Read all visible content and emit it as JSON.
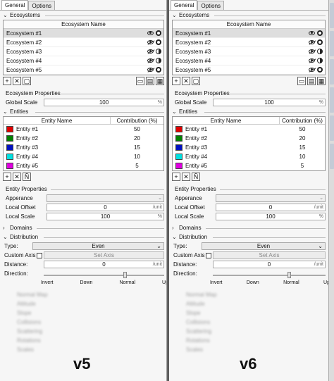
{
  "panels": [
    {
      "tabs": [
        "General",
        "Options"
      ],
      "ecosystems": {
        "header": "Ecosystems",
        "column": "Ecosystem Name",
        "items": [
          {
            "name": "Ecosystem #1",
            "eye": "eye-icon",
            "mode": "gear-icon"
          },
          {
            "name": "Ecosystem #2",
            "eye": "eye-hidden-icon",
            "mode": "gear-icon"
          },
          {
            "name": "Ecosystem #3",
            "eye": "eye-hidden-icon",
            "mode": "half-circle-icon"
          },
          {
            "name": "Ecosystem #4",
            "eye": "eye-hidden-icon",
            "mode": "half-circle-icon"
          },
          {
            "name": "Ecosystem #5",
            "eye": "eye-hidden-icon",
            "mode": "gear-icon"
          }
        ],
        "toolbar": [
          "+",
          "✕",
          "▢"
        ],
        "toolbar_right": [
          "▭",
          "▤",
          "▦"
        ]
      },
      "eco_props": {
        "header": "Ecosystem Properties",
        "scale_label": "Global Scale",
        "scale_value": "100",
        "scale_unit": "%"
      },
      "entities": {
        "header": "Entities",
        "col_name": "Entity Name",
        "col_contrib": "Contribution (%)",
        "items": [
          {
            "name": "Entity #1",
            "value": "50",
            "color": "#e00000"
          },
          {
            "name": "Entity #2",
            "value": "20",
            "color": "#008000"
          },
          {
            "name": "Entity #3",
            "value": "15",
            "color": "#0010c0"
          },
          {
            "name": "Entity #4",
            "value": "10",
            "color": "#00e0e0"
          },
          {
            "name": "Entity #5",
            "value": "5",
            "color": "#e000e0"
          }
        ],
        "toolbar": [
          "+",
          "✕",
          "Ñ"
        ]
      },
      "entity_props": {
        "header": "Entity Properties",
        "appearance_label": "Apperance",
        "offset_label": "Local Offset",
        "offset_value": "0",
        "offset_unit": "/unit",
        "scale_label": "Local Scale",
        "scale_value": "100",
        "scale_unit": "%"
      },
      "domains": {
        "header": "Domains"
      },
      "distribution": {
        "header": "Distribution",
        "type_label": "Type:",
        "type_value": "Even",
        "custom_axis_label": "Custom Axis",
        "set_axis": "Set Axis",
        "distance_label": "Distance:",
        "distance_value": "0",
        "distance_unit": "/unit",
        "direction_label": "Direction:",
        "direction_ticks": [
          "Invert",
          "Down",
          "Normal",
          "Up"
        ]
      },
      "blurred_items": [
        "Normal Map",
        "Altitude",
        "Slope",
        "Collisions",
        "Scattering",
        "Rotations",
        "Scales"
      ],
      "version": "v5"
    },
    {
      "tabs": [
        "General",
        "Options"
      ],
      "ecosystems": {
        "header": "Ecosystems",
        "column": "Ecosystem Name",
        "items": [
          {
            "name": "Ecosystem #1",
            "eye": "eye-icon",
            "mode": "gear-icon"
          },
          {
            "name": "Ecosystem #2",
            "eye": "eye-hidden-icon",
            "mode": "gear-icon"
          },
          {
            "name": "Ecosystem #3",
            "eye": "eye-hidden-icon",
            "mode": "half-circle-icon"
          },
          {
            "name": "Ecosystem #4",
            "eye": "eye-hidden-icon",
            "mode": "half-circle-icon"
          },
          {
            "name": "Ecosystem #5",
            "eye": "eye-hidden-icon",
            "mode": "gear-icon"
          }
        ],
        "toolbar": [
          "+",
          "✕",
          "▢"
        ],
        "toolbar_right": [
          "▭",
          "▤",
          "▦"
        ]
      },
      "eco_props": {
        "header": "Ecosystem Properties",
        "scale_label": "Global Scale",
        "scale_value": "100",
        "scale_unit": "%"
      },
      "entities": {
        "header": "Entities",
        "col_name": "Entity Name",
        "col_contrib": "Contribution (%)",
        "items": [
          {
            "name": "Entity #1",
            "value": "50",
            "color": "#e00000"
          },
          {
            "name": "Entity #2",
            "value": "20",
            "color": "#008000"
          },
          {
            "name": "Entity #3",
            "value": "15",
            "color": "#0010c0"
          },
          {
            "name": "Entity #4",
            "value": "10",
            "color": "#00e0e0"
          },
          {
            "name": "Entity #5",
            "value": "5",
            "color": "#e000e0"
          }
        ],
        "toolbar": [
          "+",
          "✕",
          "Ñ"
        ]
      },
      "entity_props": {
        "header": "Entity Properties",
        "appearance_label": "Apperance",
        "offset_label": "Local Offset",
        "offset_value": "0",
        "offset_unit": "/unit",
        "scale_label": "Local Scale",
        "scale_value": "100",
        "scale_unit": "%"
      },
      "domains": {
        "header": "Domains"
      },
      "distribution": {
        "header": "Distribution",
        "type_label": "Type:",
        "type_value": "Even",
        "custom_axis_label": "Custom Axis",
        "set_axis": "Set Axis",
        "distance_label": "Distance:",
        "distance_value": "0",
        "distance_unit": "/unit",
        "direction_label": "Direction:",
        "direction_ticks": [
          "Invert",
          "Down",
          "Normal",
          "Up"
        ]
      },
      "blurred_items": [
        "Normal Map",
        "Altitude",
        "Slope",
        "Collisions",
        "Scattering",
        "Rotations",
        "Scales"
      ],
      "version": "v6"
    }
  ]
}
